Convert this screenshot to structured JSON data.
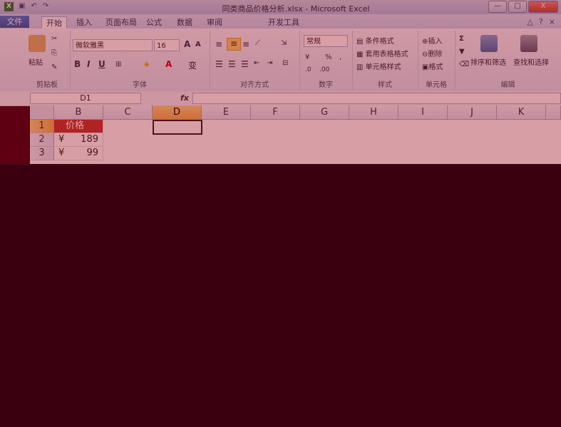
{
  "window": {
    "title": "同类商品价格分析.xlsx - Microsoft Excel",
    "app_icon": "X",
    "controls": [
      "—",
      "□",
      "X"
    ]
  },
  "tabs": [
    {
      "label": "文件"
    },
    {
      "label": "开始"
    },
    {
      "label": "插入"
    },
    {
      "label": "页面布局"
    },
    {
      "label": "公式"
    },
    {
      "label": "数据"
    },
    {
      "label": "审阅"
    },
    {
      "label": "开发工具"
    }
  ],
  "ribbon": {
    "clipboard": {
      "label": "剪贴板",
      "paste": "粘贴"
    },
    "font": {
      "label": "字体",
      "name": "微软雅黑",
      "size": "16",
      "bold": "B",
      "italic": "I",
      "underline": "U"
    },
    "alignment": {
      "label": "对齐方式"
    },
    "number": {
      "label": "数字",
      "format": "常规",
      "percent": "%",
      "comma": ","
    },
    "styles": {
      "label": "样式",
      "conditional": "条件格式",
      "table": "套用表格格式",
      "cell": "单元格样式"
    },
    "cells": {
      "label": "单元格",
      "insert": "插入",
      "delete": "删除",
      "format": "格式"
    },
    "editing": {
      "label": "编辑",
      "sort": "排序和筛选",
      "find": "查找和选择",
      "sigma": "Σ"
    }
  },
  "formula_bar": {
    "name_box": "D1",
    "fx": "fx",
    "content": ""
  },
  "sheet": {
    "columns": [
      "B",
      "C",
      "D",
      "E",
      "F",
      "G",
      "H",
      "I",
      "J",
      "K"
    ],
    "selected_column": "D",
    "rows": [
      {
        "num": "1",
        "b": "价格"
      },
      {
        "num": "2",
        "currency": "¥",
        "value": "189"
      },
      {
        "num": "3",
        "currency": "¥",
        "value": "99"
      }
    ]
  },
  "colors": {
    "header_fill": "#c0392b",
    "overlay": "#3b0010",
    "file_tab": "#2a63b3"
  }
}
